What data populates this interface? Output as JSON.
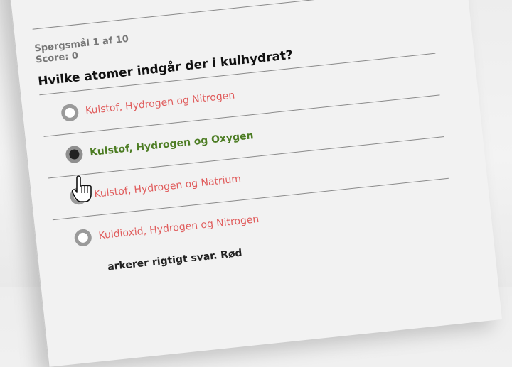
{
  "quiz": {
    "progress": "Spørgsmål 1 af 10",
    "score": "Score: 0",
    "question": "Hvilke atomer indgår der i kulhydrat?",
    "options": [
      {
        "label": "Kulstof, Hydrogen og Nitrogen",
        "state": "wrong"
      },
      {
        "label": "Kulstof, Hydrogen og Oxygen",
        "state": "correct",
        "selected": true
      },
      {
        "label": "Kulstof, Hydrogen og Natrium",
        "state": "wrong"
      },
      {
        "label": "Kuldioxid, Hydrogen og Nitrogen",
        "state": "wrong"
      }
    ],
    "feedback": "arkerer rigtigt svar. Rød"
  },
  "colors": {
    "wrong": "#e05c5c",
    "correct": "#4d7d24",
    "radio_ring": "#9a9a9a",
    "cursor": "hand-pointer-icon"
  }
}
